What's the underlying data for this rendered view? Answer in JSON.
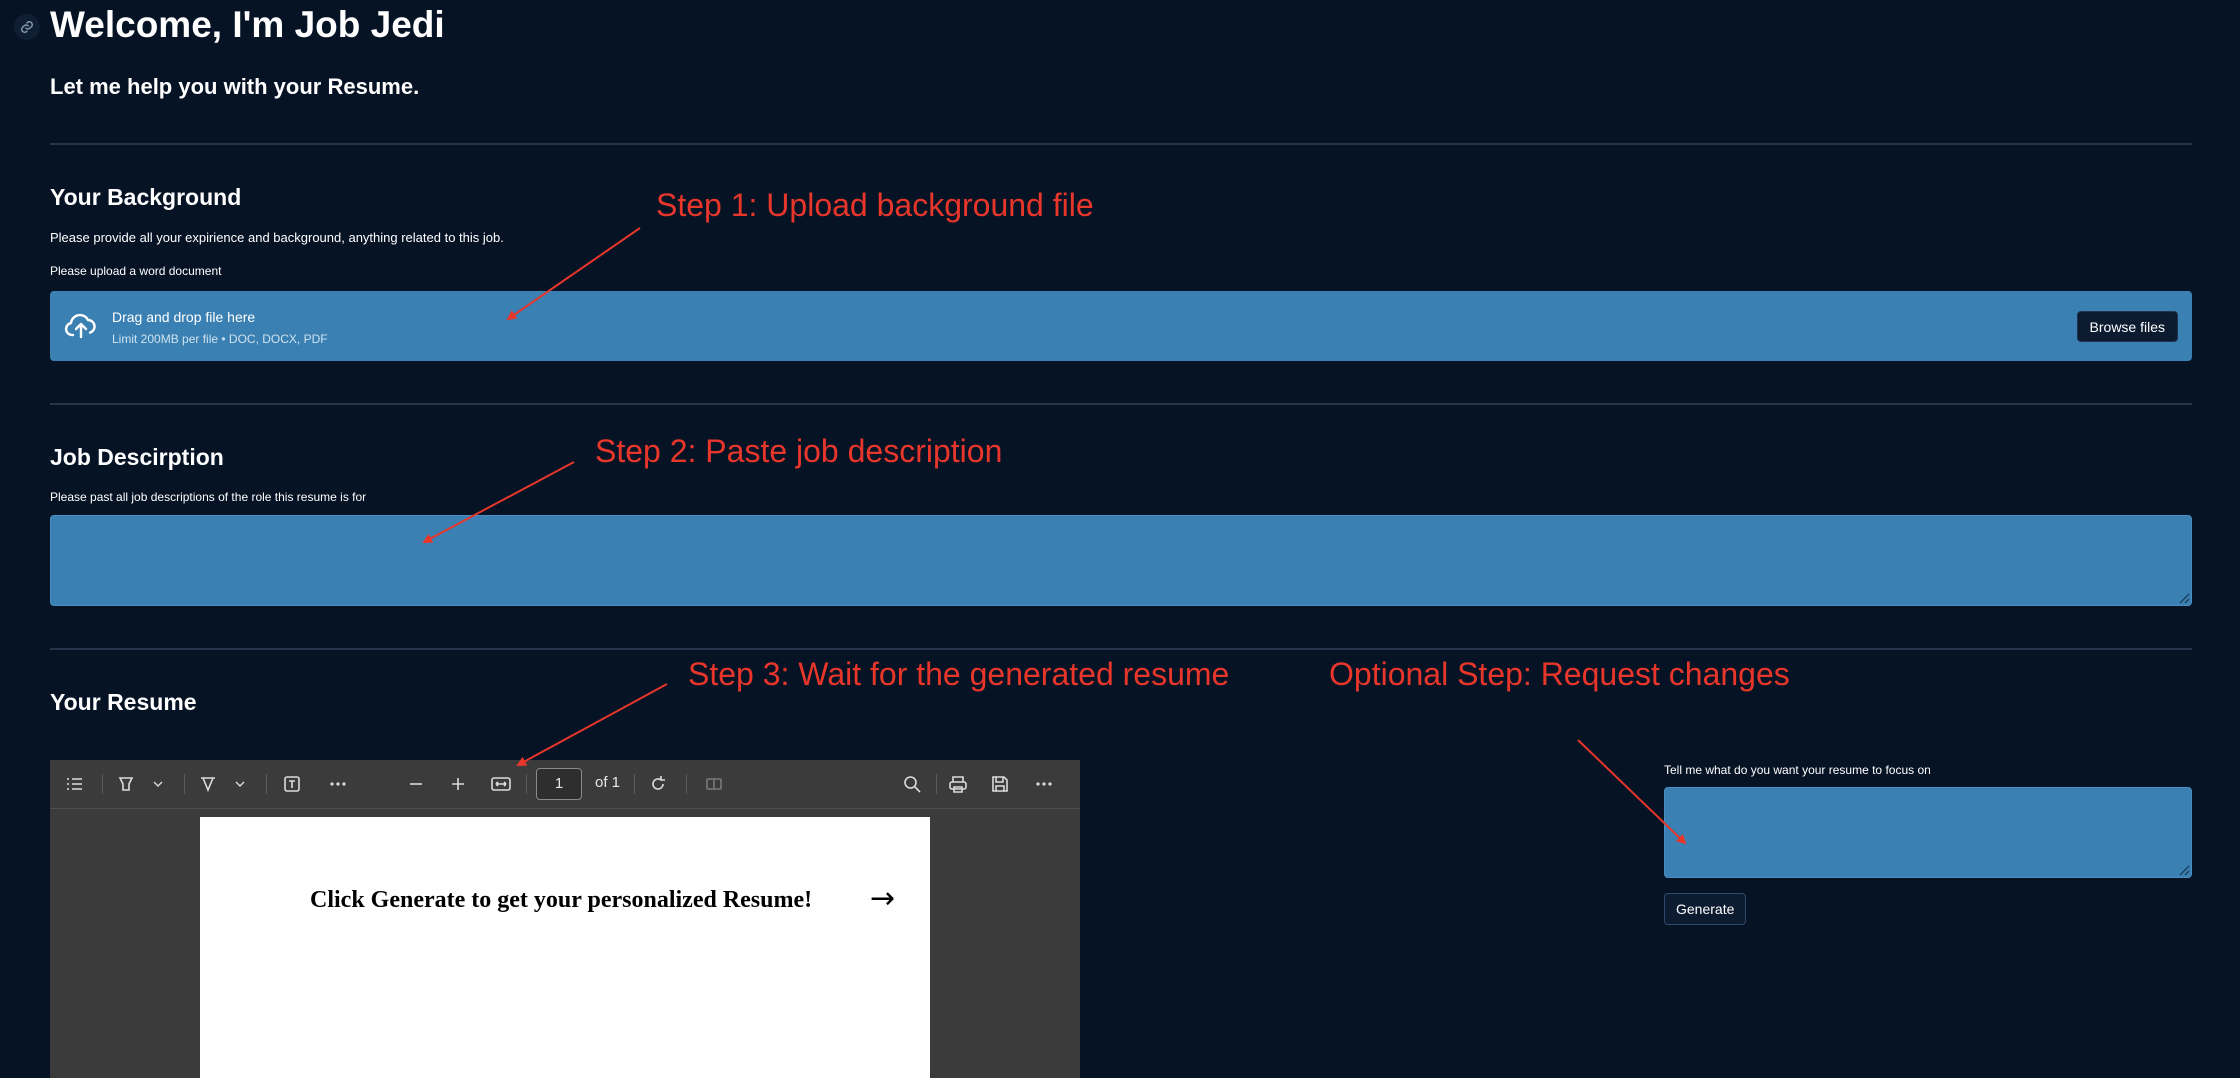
{
  "header": {
    "title": "Welcome, I'm Job Jedi",
    "subtitle": "Let me help you with your Resume."
  },
  "background": {
    "heading": "Your Background",
    "description": "Please provide all your expirience and background, anything related to this job.",
    "upload_label": "Please upload a word document",
    "uploader": {
      "drop_text": "Drag and drop file here",
      "limit_text": "Limit 200MB per file • DOC, DOCX, PDF",
      "browse_label": "Browse files"
    }
  },
  "job": {
    "heading": "Job Descirption",
    "label": "Please past all job descriptions of the role this resume is for",
    "value": ""
  },
  "resume": {
    "heading": "Your Resume",
    "viewer": {
      "page_number": "1",
      "page_total": "of 1",
      "message": "Click Generate to get your personalized Resume!",
      "arrow": "→"
    },
    "focus_label": "Tell me what do you want your resume to focus on",
    "focus_value": "",
    "generate_label": "Generate"
  },
  "annotations": {
    "step1": "Step 1: Upload background file",
    "step2": "Step 2: Paste job description",
    "step3": "Step 3: Wait for the generated resume",
    "optional": "Optional Step: Request changes"
  },
  "colors": {
    "background": "#061325",
    "input_fill": "#3a80b3",
    "annotation": "#e8362b"
  }
}
